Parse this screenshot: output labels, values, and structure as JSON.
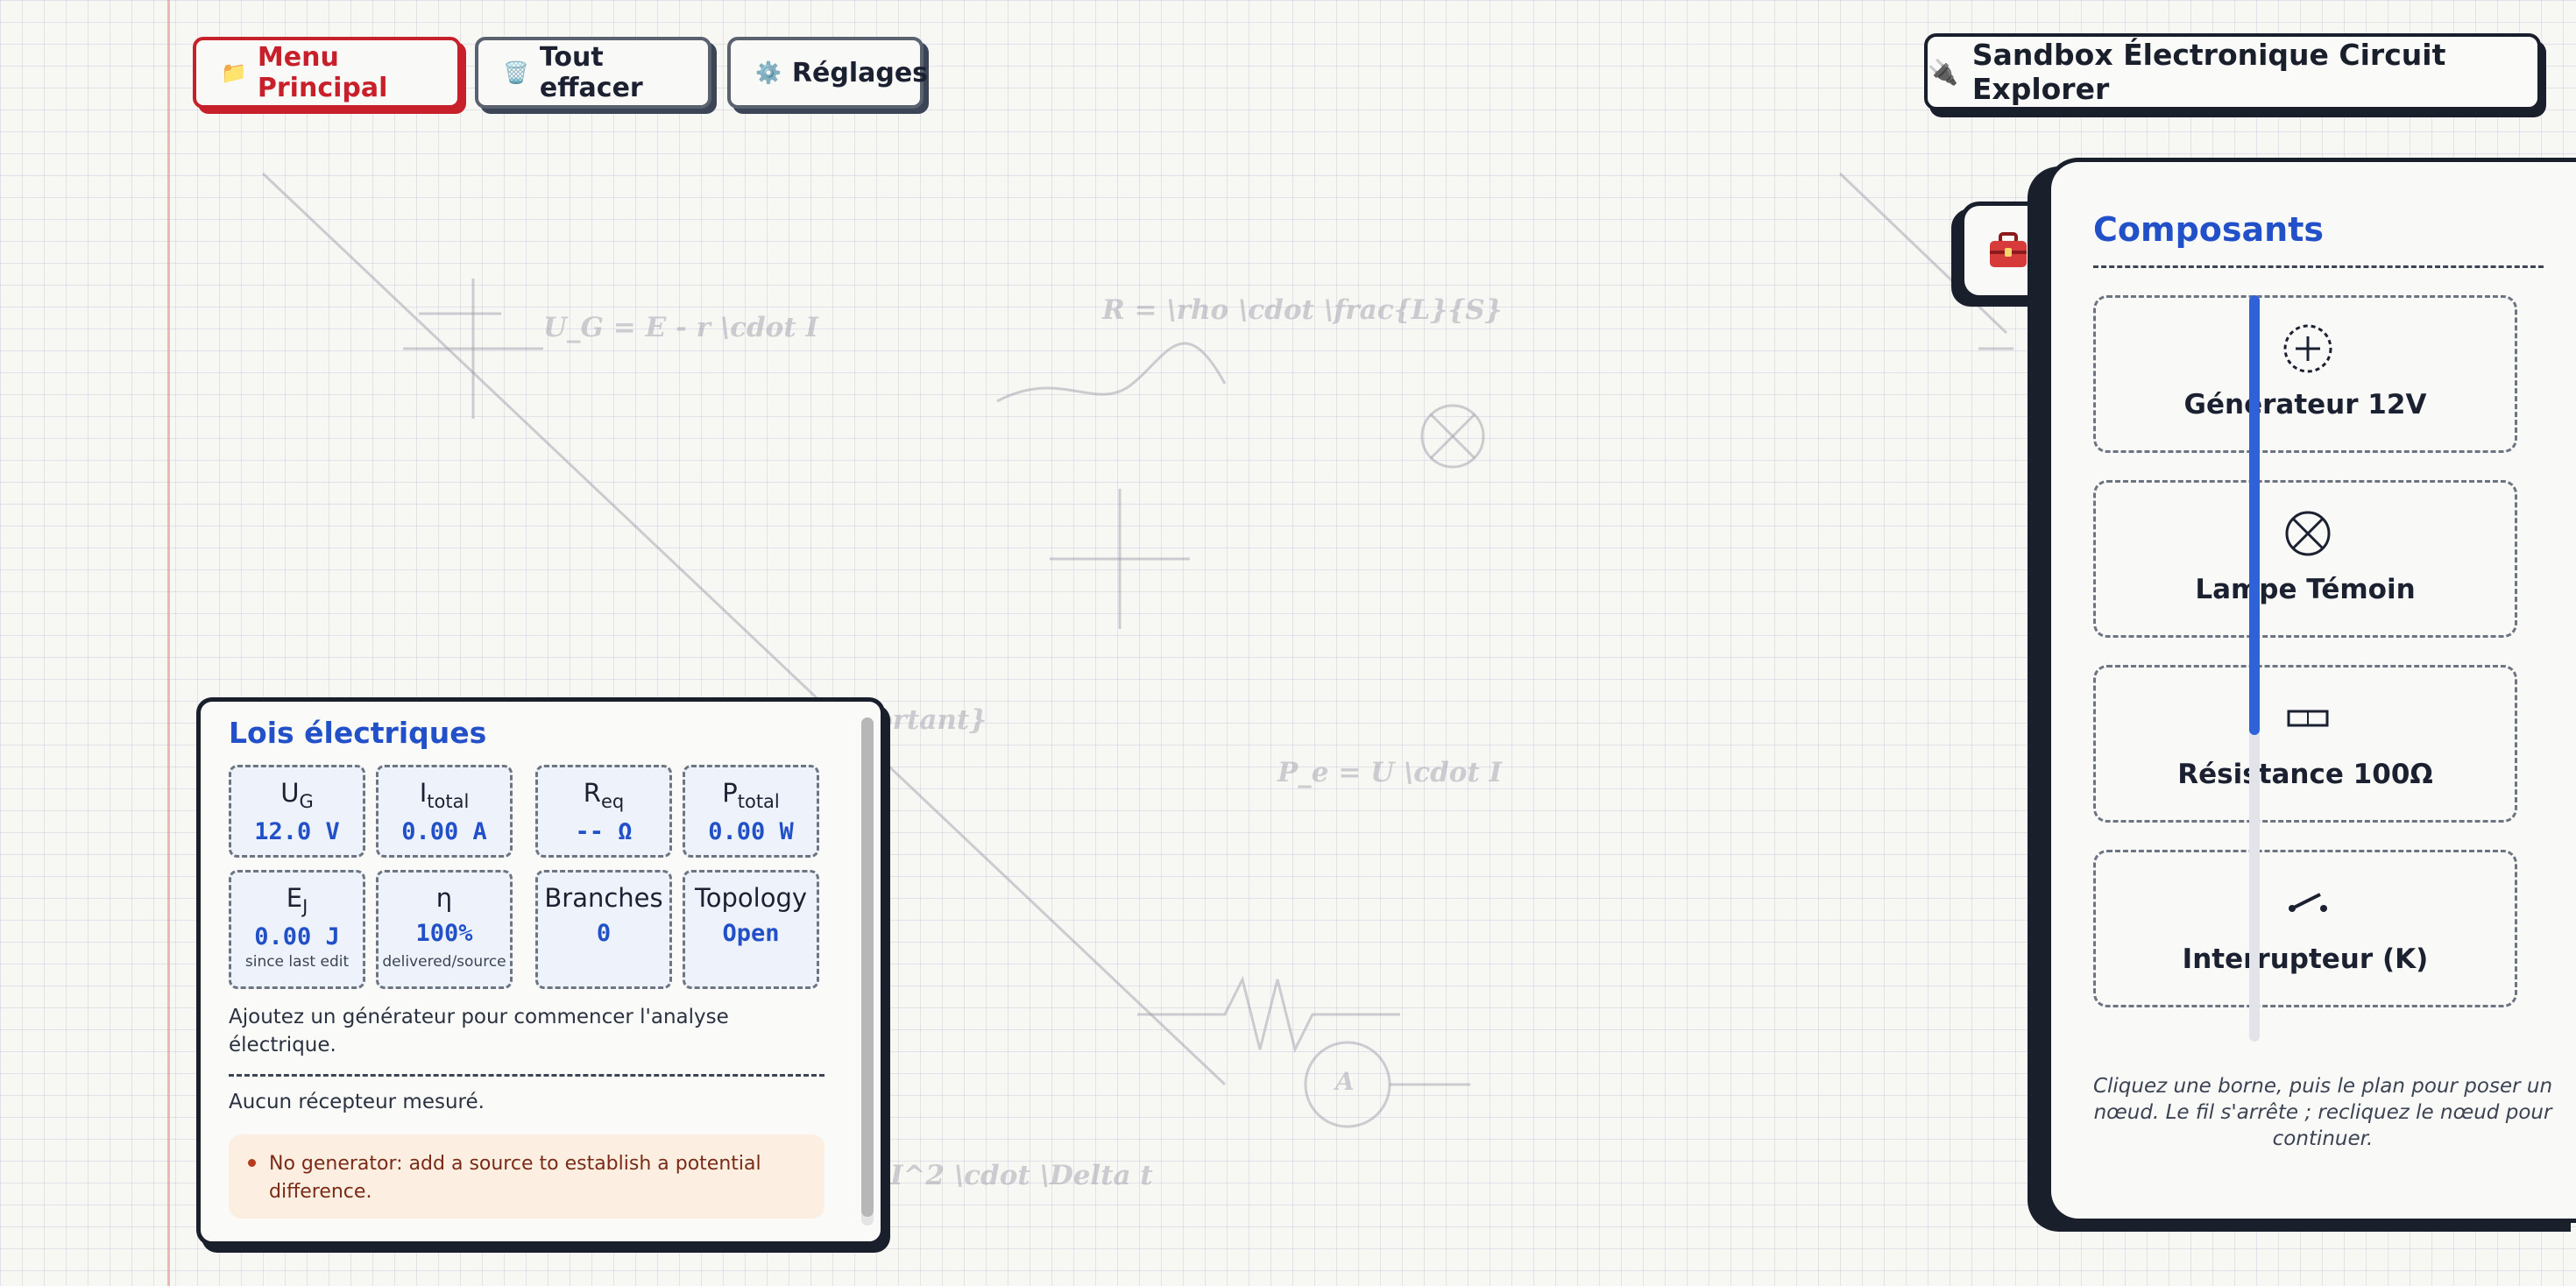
{
  "toolbar": {
    "main_menu_icon": "📁",
    "main_menu_label": "Menu Principal",
    "clear_icon": "🗑️",
    "clear_label": "Tout effacer",
    "settings_icon": "⚙️",
    "settings_label": "Réglages"
  },
  "app": {
    "title_icon": "🔌",
    "title": "Sandbox Électronique Circuit Explorer"
  },
  "background_formulas": [
    "U_G = E - r \\cdot I",
    "R = \\rho \\cdot \\frac{L}{S}",
    "ortant}",
    "P_e = U \\cdot I",
    "I^2 \\cdot \\Delta t",
    "A"
  ],
  "components_panel": {
    "toggle_icon": "toolbox-icon",
    "title": "Composants",
    "items": [
      {
        "icon": "generator-icon",
        "label": "Générateur 12V"
      },
      {
        "icon": "lamp-icon",
        "label": "Lampe Témoin"
      },
      {
        "icon": "resistor-icon",
        "label": "Résistance 100Ω"
      },
      {
        "icon": "switch-icon",
        "label": "Interrupteur (K)"
      }
    ],
    "hint": "Cliquez une borne, puis le plan pour poser un nœud. Le fil s'arrête ; recliquez le nœud pour continuer.",
    "accent_color": "#2f62d8"
  },
  "laws_panel": {
    "title": "Lois électriques",
    "metrics": [
      {
        "label": "U",
        "sub": "G",
        "value": "12.0 V",
        "note": ""
      },
      {
        "label": "I",
        "sub": "total",
        "value": "0.00 A",
        "note": ""
      },
      {
        "label": "R",
        "sub": "eq",
        "value": "-- Ω",
        "note": ""
      },
      {
        "label": "P",
        "sub": "total",
        "value": "0.00 W",
        "note": ""
      },
      {
        "label": "E",
        "sub": "J",
        "value": "0.00 J",
        "note": "since last edit"
      },
      {
        "label": "η",
        "sub": "",
        "value": "100%",
        "note": "delivered/source"
      },
      {
        "label": "Branches",
        "sub": "",
        "value": "0",
        "note": ""
      },
      {
        "label": "Topology",
        "sub": "",
        "value": "Open",
        "note": ""
      }
    ],
    "message": "Ajoutez un générateur pour commencer l'analyse électrique.",
    "receivers_message": "Aucun récepteur mesuré.",
    "warning": "No generator: add a source to establish a potential difference."
  },
  "colors": {
    "accent_blue": "#2150c8",
    "menu_red": "#c8202a",
    "ink": "#1a1f2c"
  }
}
